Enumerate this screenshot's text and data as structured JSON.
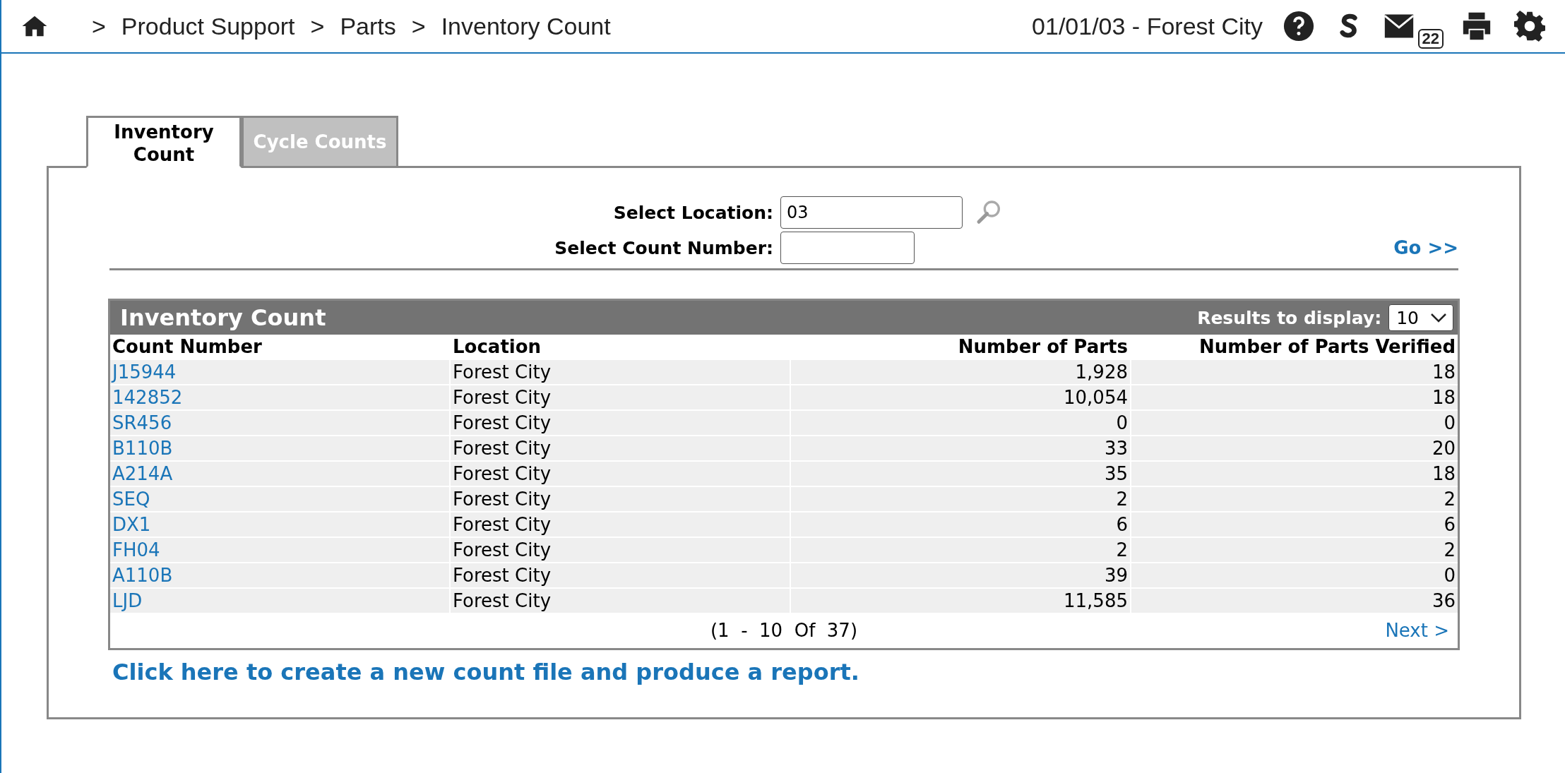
{
  "header": {
    "breadcrumb": [
      {
        "separator": ">",
        "label": "Product Support"
      },
      {
        "separator": ">",
        "label": "Parts"
      },
      {
        "separator": ">",
        "label": "Inventory Count"
      }
    ],
    "context": "01/01/03 - Forest City",
    "mail_badge": "22"
  },
  "tabs": [
    {
      "label": "Inventory Count",
      "selected": true
    },
    {
      "label": "Cycle Counts",
      "selected": false
    }
  ],
  "form": {
    "fields": [
      {
        "label": "Select Location:",
        "value": "03",
        "lookup": true
      },
      {
        "label": "Select Count Number:",
        "lookup": false
      }
    ],
    "go": "Go >>"
  },
  "table": {
    "title": "Inventory Count",
    "results_label": "Results to display:",
    "results_value": "10",
    "columns": [
      "Count Number",
      "Location",
      "Number of Parts",
      "Number of Parts Verified"
    ],
    "rows": [
      [
        "J15944",
        "Forest City",
        "1,928",
        "18"
      ],
      [
        "142852",
        "Forest City",
        "10,054",
        "18"
      ],
      [
        "SR456",
        "Forest City",
        "0",
        "0"
      ],
      [
        "B110B",
        "Forest City",
        "33",
        "20"
      ],
      [
        "A214A",
        "Forest City",
        "35",
        "18"
      ],
      [
        "SEQ",
        "Forest City",
        "2",
        "2"
      ],
      [
        "DX1",
        "Forest City",
        "6",
        "6"
      ],
      [
        "FH04",
        "Forest City",
        "2",
        "2"
      ],
      [
        "A110B",
        "Forest City",
        "39",
        "0"
      ],
      [
        "LJD",
        "Forest City",
        "11,585",
        "36"
      ]
    ],
    "pagination": "(1  -  10  Of  37)",
    "next": "Next >"
  },
  "create_link": "Click here to create a new count file and produce a report."
}
